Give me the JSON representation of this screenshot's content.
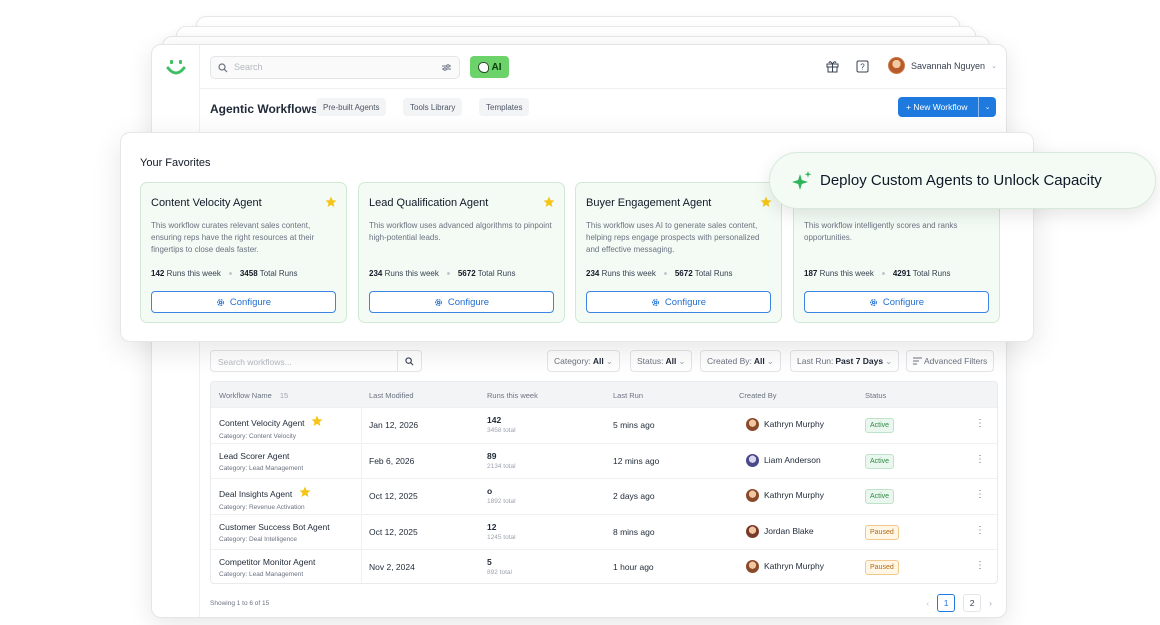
{
  "header": {
    "search_placeholder": "Search",
    "ai_label": "AI",
    "user_name": "Savannah Nguyen"
  },
  "subheader": {
    "title": "Agentic Workflows",
    "chips": [
      "Pre-built Agents",
      "Tools Library",
      "Templates"
    ],
    "new_workflow_label": "+ New Workflow"
  },
  "favorites": {
    "title": "Your Favorites",
    "cards": [
      {
        "title": "Content Velocity Agent",
        "desc": "This workflow curates relevant sales content, ensuring reps have the right resources at their fingertips to close deals faster.",
        "runs_week": "142",
        "runs_week_label": "Runs this week",
        "total": "3458",
        "total_label": "Total Runs",
        "button": "Configure"
      },
      {
        "title": "Lead Qualification Agent",
        "desc": "This workflow uses advanced algorithms to pinpoint high-potential leads.",
        "runs_week": "234",
        "runs_week_label": "Runs this week",
        "total": "5672",
        "total_label": "Total Runs",
        "button": "Configure"
      },
      {
        "title": "Buyer Engagement Agent",
        "desc": "This workflow uses AI to generate sales content, helping reps engage prospects with personalized and effective messaging.",
        "runs_week": "234",
        "runs_week_label": "Runs this week",
        "total": "5672",
        "total_label": "Total Runs",
        "button": "Configure"
      },
      {
        "title": "",
        "desc": "This workflow intelligently scores and ranks opportunities.",
        "runs_week": "187",
        "runs_week_label": "Runs this week",
        "total": "4291",
        "total_label": "Total Runs",
        "button": "Configure"
      }
    ]
  },
  "callout": {
    "text": "Deploy Custom Agents to Unlock Capacity"
  },
  "filters": {
    "search_placeholder": "Search  workflows...",
    "category_label": "Category:",
    "category_value": "All",
    "status_label": "Status:",
    "status_value": "All",
    "created_label": "Created By:",
    "created_value": "All",
    "lastrun_label": "Last Run:",
    "lastrun_value": "Past 7 Days",
    "advanced": "Advanced Filters"
  },
  "table": {
    "headers": {
      "name": "Workflow Name",
      "count": "15",
      "modified": "Last Modified",
      "runs": "Runs this week",
      "last_run": "Last Run",
      "created_by": "Created By",
      "status": "Status"
    },
    "rows": [
      {
        "name": "Content Velocity Agent",
        "starred": true,
        "category": "Category: Content Velocity",
        "modified": "Jan 12, 2026",
        "runs": "142",
        "runs_total": "3458 total",
        "last_run": "5 mins ago",
        "created_by": "Kathryn Murphy",
        "status": "Active"
      },
      {
        "name": "Lead Scorer Agent",
        "starred": false,
        "category": "Category: Lead Management",
        "modified": "Feb 6, 2026",
        "runs": "89",
        "runs_total": "2134 total",
        "last_run": "12 mins ago",
        "created_by": "Liam Anderson",
        "status": "Active"
      },
      {
        "name": "Deal Insights Agent",
        "starred": true,
        "category": "Category: Revenue Activation",
        "modified": "Oct 12, 2025",
        "runs": "o",
        "runs_total": "1892 total",
        "last_run": "2 days ago",
        "created_by": "Kathryn Murphy",
        "status": "Active"
      },
      {
        "name": "Customer Success Bot Agent",
        "starred": false,
        "category": "Category: Deal Intelligence",
        "modified": "Oct 12, 2025",
        "runs": "12",
        "runs_total": "1245 total",
        "last_run": "8 mins ago",
        "created_by": "Jordan Blake",
        "status": "Paused"
      },
      {
        "name": "Competitor Monitor Agent",
        "starred": false,
        "category": "Category: Lead Management",
        "modified": "Nov 2, 2024",
        "runs": "5",
        "runs_total": "892 total",
        "last_run": "1 hour ago",
        "created_by": "Kathryn Murphy",
        "status": "Paused"
      }
    ]
  },
  "footer": {
    "showing": "Showing 1 to 6 of 15",
    "pages": [
      "1",
      "2"
    ]
  },
  "colors": {
    "accent": "#1f7ae0",
    "ai_green": "#6bd36a",
    "active": "#2f8a45",
    "paused": "#b06a12",
    "star": "#f5c518"
  }
}
